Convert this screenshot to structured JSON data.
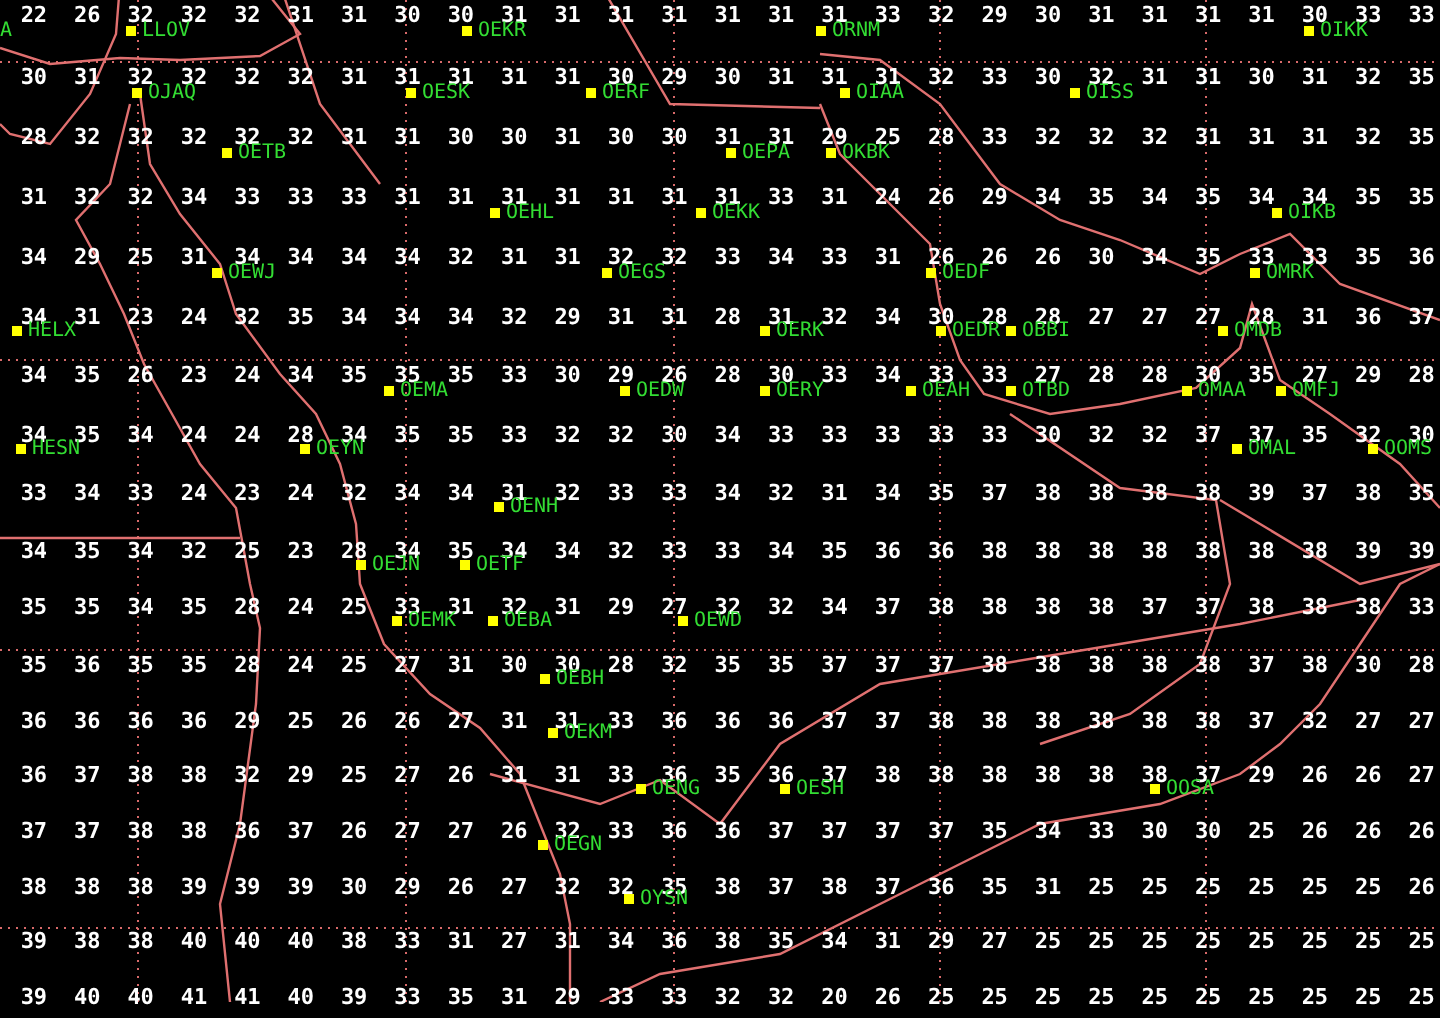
{
  "grid": {
    "rows": [
      [
        "22",
        "26",
        "32",
        "32",
        "32",
        "31",
        "31",
        "30",
        "30",
        "31",
        "31",
        "31",
        "31",
        "31",
        "31",
        "31",
        "33",
        "32",
        "29",
        "30",
        "31",
        "31",
        "31",
        "31",
        "30",
        "33",
        "33"
      ],
      [
        "30",
        "31",
        "32",
        "32",
        "32",
        "32",
        "31",
        "31",
        "31",
        "31",
        "31",
        "30",
        "29",
        "30",
        "31",
        "31",
        "31",
        "32",
        "33",
        "30",
        "32",
        "31",
        "31",
        "30",
        "31",
        "32",
        "35"
      ],
      [
        "28",
        "32",
        "32",
        "32",
        "32",
        "32",
        "31",
        "31",
        "30",
        "30",
        "31",
        "30",
        "30",
        "31",
        "31",
        "29",
        "25",
        "28",
        "33",
        "32",
        "32",
        "32",
        "31",
        "31",
        "31",
        "32",
        "35"
      ],
      [
        "31",
        "32",
        "32",
        "34",
        "33",
        "33",
        "33",
        "31",
        "31",
        "31",
        "31",
        "31",
        "31",
        "31",
        "33",
        "31",
        "24",
        "26",
        "29",
        "34",
        "35",
        "34",
        "35",
        "34",
        "34",
        "35",
        "35"
      ],
      [
        "34",
        "29",
        "25",
        "31",
        "34",
        "34",
        "34",
        "34",
        "32",
        "31",
        "31",
        "32",
        "32",
        "33",
        "34",
        "33",
        "31",
        "26",
        "26",
        "26",
        "30",
        "34",
        "35",
        "33",
        "33",
        "35",
        "36"
      ],
      [
        "34",
        "31",
        "23",
        "24",
        "32",
        "35",
        "34",
        "34",
        "34",
        "32",
        "29",
        "31",
        "31",
        "28",
        "31",
        "32",
        "34",
        "30",
        "28",
        "28",
        "27",
        "27",
        "27",
        "28",
        "31",
        "36",
        "37"
      ],
      [
        "34",
        "35",
        "26",
        "23",
        "24",
        "34",
        "35",
        "35",
        "35",
        "33",
        "30",
        "29",
        "26",
        "28",
        "30",
        "33",
        "34",
        "33",
        "33",
        "27",
        "28",
        "28",
        "30",
        "35",
        "27",
        "29",
        "28"
      ],
      [
        "34",
        "35",
        "34",
        "24",
        "24",
        "28",
        "34",
        "35",
        "35",
        "33",
        "32",
        "32",
        "30",
        "34",
        "33",
        "33",
        "33",
        "33",
        "33",
        "30",
        "32",
        "32",
        "37",
        "37",
        "35",
        "32",
        "30"
      ],
      [
        "33",
        "34",
        "33",
        "24",
        "23",
        "24",
        "32",
        "34",
        "34",
        "31",
        "32",
        "33",
        "33",
        "34",
        "32",
        "31",
        "34",
        "35",
        "37",
        "38",
        "38",
        "38",
        "38",
        "39",
        "37",
        "38",
        "35"
      ],
      [
        "34",
        "35",
        "34",
        "32",
        "25",
        "23",
        "28",
        "34",
        "35",
        "34",
        "34",
        "32",
        "33",
        "33",
        "34",
        "35",
        "36",
        "36",
        "38",
        "38",
        "38",
        "38",
        "38",
        "38",
        "38",
        "39",
        "39"
      ],
      [
        "35",
        "35",
        "34",
        "35",
        "28",
        "24",
        "25",
        "33",
        "31",
        "32",
        "31",
        "29",
        "27",
        "32",
        "32",
        "34",
        "37",
        "38",
        "38",
        "38",
        "38",
        "37",
        "37",
        "38",
        "38",
        "38",
        "33"
      ],
      [
        "35",
        "36",
        "35",
        "35",
        "28",
        "24",
        "25",
        "27",
        "31",
        "30",
        "30",
        "28",
        "32",
        "35",
        "35",
        "37",
        "37",
        "37",
        "38",
        "38",
        "38",
        "38",
        "38",
        "37",
        "38",
        "30",
        "28"
      ],
      [
        "36",
        "36",
        "36",
        "36",
        "29",
        "25",
        "26",
        "26",
        "27",
        "31",
        "31",
        "33",
        "36",
        "36",
        "36",
        "37",
        "37",
        "38",
        "38",
        "38",
        "38",
        "38",
        "38",
        "37",
        "32",
        "27",
        "27"
      ],
      [
        "36",
        "37",
        "38",
        "38",
        "32",
        "29",
        "25",
        "27",
        "26",
        "31",
        "31",
        "33",
        "36",
        "35",
        "36",
        "37",
        "38",
        "38",
        "38",
        "38",
        "38",
        "38",
        "37",
        "29",
        "26",
        "26",
        "27"
      ],
      [
        "37",
        "37",
        "38",
        "38",
        "36",
        "37",
        "26",
        "27",
        "27",
        "26",
        "32",
        "33",
        "36",
        "36",
        "37",
        "37",
        "37",
        "37",
        "35",
        "34",
        "33",
        "30",
        "30",
        "25",
        "26",
        "26",
        "26"
      ],
      [
        "38",
        "38",
        "38",
        "39",
        "39",
        "39",
        "30",
        "29",
        "26",
        "27",
        "32",
        "32",
        "35",
        "38",
        "37",
        "38",
        "37",
        "36",
        "35",
        "31",
        "25",
        "25",
        "25",
        "25",
        "25",
        "25",
        "26"
      ],
      [
        "39",
        "38",
        "38",
        "40",
        "40",
        "40",
        "38",
        "33",
        "31",
        "27",
        "31",
        "34",
        "36",
        "38",
        "35",
        "34",
        "31",
        "29",
        "27",
        "25",
        "25",
        "25",
        "25",
        "25",
        "25",
        "25",
        "25"
      ],
      [
        "39",
        "40",
        "40",
        "41",
        "41",
        "40",
        "39",
        "33",
        "35",
        "31",
        "29",
        "33",
        "33",
        "32",
        "32",
        "20",
        "26",
        "25",
        "25",
        "25",
        "25",
        "25",
        "25",
        "25",
        "25",
        "25",
        "25"
      ]
    ]
  },
  "stations": [
    {
      "code": "A"
    },
    {
      "code": "LLOV"
    },
    {
      "code": "OEKR"
    },
    {
      "code": "ORNM"
    },
    {
      "code": "OIKK"
    },
    {
      "code": "OJAQ"
    },
    {
      "code": "OESK"
    },
    {
      "code": "OERF"
    },
    {
      "code": "OIAA"
    },
    {
      "code": "OISS"
    },
    {
      "code": "OETB"
    },
    {
      "code": "OEPA"
    },
    {
      "code": "OKBK"
    },
    {
      "code": "OEHL"
    },
    {
      "code": "OEKK"
    },
    {
      "code": "OIKB"
    },
    {
      "code": "OEWJ"
    },
    {
      "code": "OEGS"
    },
    {
      "code": "OEDF"
    },
    {
      "code": "OMRK"
    },
    {
      "code": "HELX"
    },
    {
      "code": "OERK"
    },
    {
      "code": "OEDR"
    },
    {
      "code": "OBBI"
    },
    {
      "code": "OMDB"
    },
    {
      "code": "OEMA"
    },
    {
      "code": "OEDW"
    },
    {
      "code": "OERY"
    },
    {
      "code": "OEAH"
    },
    {
      "code": "OTBD"
    },
    {
      "code": "OMAA"
    },
    {
      "code": "OMFJ"
    },
    {
      "code": "HESN"
    },
    {
      "code": "OEYN"
    },
    {
      "code": "OMAL"
    },
    {
      "code": "OOMS"
    },
    {
      "code": "OENH"
    },
    {
      "code": "OEJN"
    },
    {
      "code": "OETF"
    },
    {
      "code": "OEMK"
    },
    {
      "code": "OEBA"
    },
    {
      "code": "OEWD"
    },
    {
      "code": "OEBH"
    },
    {
      "code": "OEKM"
    },
    {
      "code": "OENG"
    },
    {
      "code": "OESH"
    },
    {
      "code": "OOSA"
    },
    {
      "code": "OEGN"
    },
    {
      "code": "OYSN"
    }
  ]
}
